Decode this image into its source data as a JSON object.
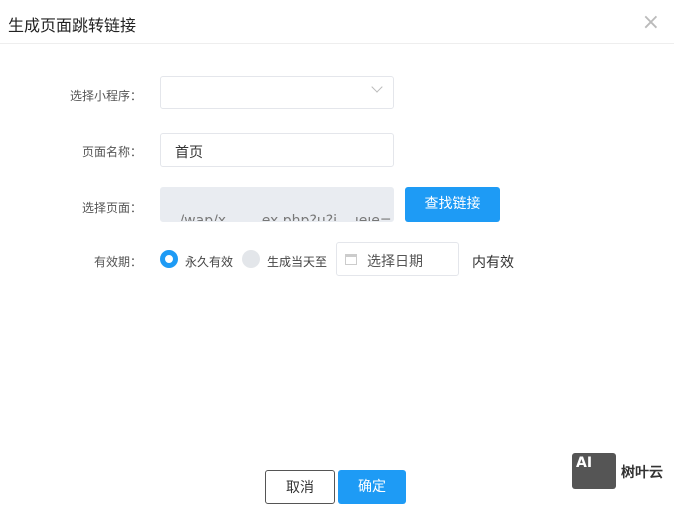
{
  "dialog": {
    "title": "生成页面跳转链接",
    "close_icon": "×"
  },
  "form": {
    "program_label": "选择小程序：",
    "program_value": "",
    "page_name_label": "页面名称：",
    "page_name_value": "首页",
    "page_label": "选择页面：",
    "page_value": "/wap/x        ex.php?u?i    ıeıe=",
    "find_button": "查找链接",
    "validity_label": "有效期：",
    "option_forever": "永久有效",
    "option_until": "生成当天至",
    "date_placeholder": "选择日期",
    "suffix": "内有效"
  },
  "footer": {
    "cancel": "取消",
    "confirm": "确定"
  },
  "watermark": {
    "logo": "AI",
    "brand": "树叶云"
  },
  "colors": {
    "accent": "#1e9bf5"
  }
}
